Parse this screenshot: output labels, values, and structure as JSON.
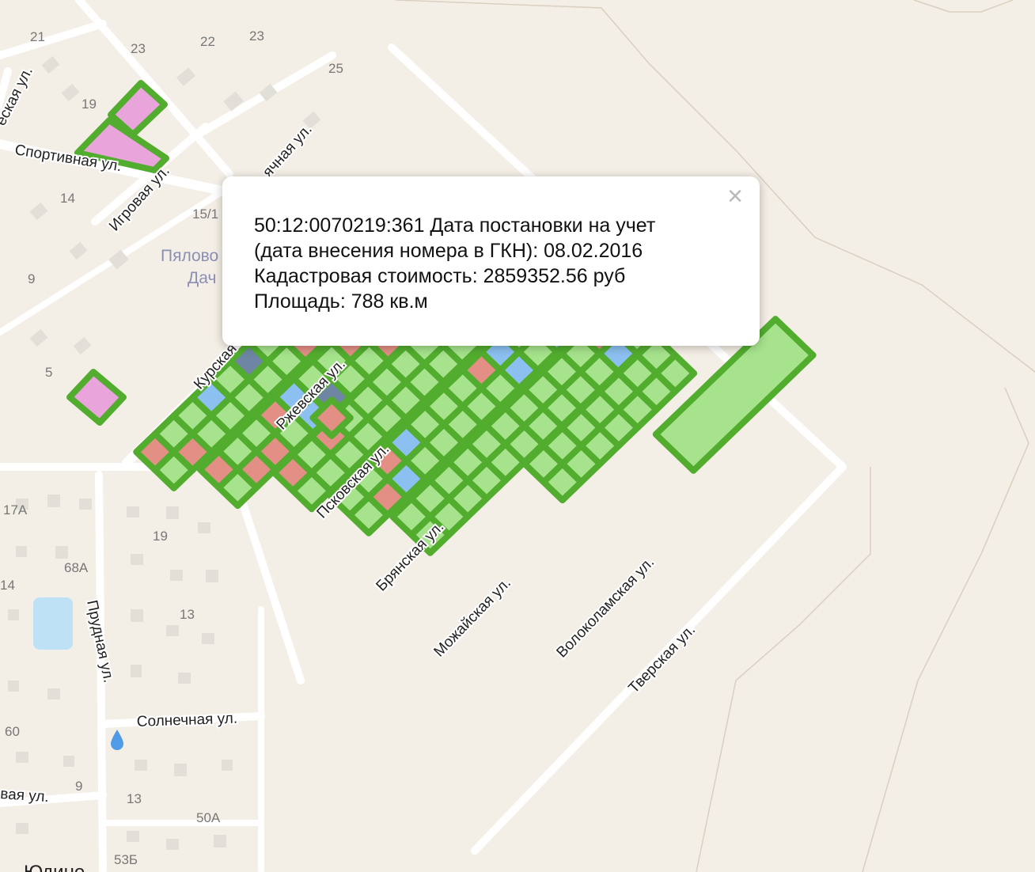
{
  "streets": {
    "sportivnaya": "Спортивная ул.",
    "igrovaya": "Игровая ул.",
    "yachnaya": "ячная ул.",
    "eskaya": "еская ул.",
    "kurskaya": "Курская",
    "rzhevskaya": "Ржевская ул.",
    "pskovskaya": "Псковская ул.",
    "bryanskaya": "Брянская ул.",
    "mozhayskaya": "Можайская ул.",
    "volokolamskaya": "Волоколамская ул.",
    "tverskaya": "Тверская ул.",
    "prudnaya": "Прудная ул.",
    "solnechnaya": "Солнечная ул.",
    "vaya": "вая ул."
  },
  "house_numbers": [
    "21",
    "23",
    "22",
    "23",
    "25",
    "19",
    "14",
    "15/1",
    "9",
    "5",
    "17А",
    "19",
    "68А",
    "14",
    "13",
    "60",
    "9",
    "13",
    "50А",
    "53Б"
  ],
  "places": {
    "settlement_line1": "Пялово",
    "settlement_line2": "Дач",
    "town": "Юдино"
  },
  "popup": {
    "line1": "50:12:0070219:361 Дата постановки на учет",
    "line2": "(дата внесения номера в ГКН): 08.02.2016",
    "line3": "Кадастровая стоимость: 2859352.56 руб",
    "line4": "Площадь: 788 кв.м",
    "close_symbol": "×"
  },
  "colors": {
    "background": "#f4efe6",
    "road": "#ffffff",
    "parcel_outline": "#52ad2f",
    "parcel_default": "#a6e38c",
    "parcel_red": "#e48f86",
    "parcel_blue": "#8cc0f0",
    "parcel_slate": "#6e86a4",
    "parcel_pink": "#eaa4dc",
    "pond": "#bfe1f5"
  }
}
